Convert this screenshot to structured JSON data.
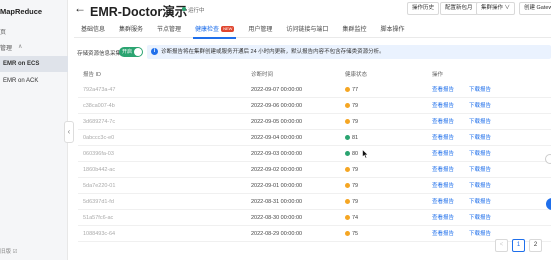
{
  "sidebar": {
    "brand": "MapReduce",
    "home": "页",
    "group_label": "管理",
    "items": [
      {
        "label": "EMR on ECS",
        "active": true
      },
      {
        "label": "EMR on ACK",
        "active": false
      }
    ],
    "footer": "旧版 ☑"
  },
  "header": {
    "back_icon": "arrow-left-icon",
    "title": "EMR-Doctor演示",
    "status": "运行中",
    "buttons": [
      "操作历史",
      "配置新包月",
      "集群操作 ∨",
      "创建 Gatewa"
    ]
  },
  "tabs": [
    {
      "label": "基础信息",
      "active": false
    },
    {
      "label": "集群服务",
      "active": false
    },
    {
      "label": "节点管理",
      "active": false
    },
    {
      "label": "健康检查",
      "active": true,
      "badge": "NEW"
    },
    {
      "label": "用户管理",
      "active": false
    },
    {
      "label": "访问链接与端口",
      "active": false
    },
    {
      "label": "集群监控",
      "active": false
    },
    {
      "label": "脚本操作",
      "active": false
    }
  ],
  "toggle": {
    "label": "存储资源信息采集",
    "state_text": "开启",
    "on": true
  },
  "notice": "诊断报告将在集群创建或服务开通后 24 小时内更新，默认报告内容不包含存储类资源分析。",
  "table": {
    "columns": [
      "报告 ID",
      "诊断时间",
      "健康状态",
      "操作"
    ],
    "actions": [
      "查看报告",
      "下载报告"
    ],
    "rows": [
      {
        "id": "792a473a-47",
        "time": "2022-09-07 00:00:00",
        "score": "77",
        "color": "#f5a623"
      },
      {
        "id": "c38ca007-4b",
        "time": "2022-09-06 00:00:00",
        "score": "79",
        "color": "#f5a623"
      },
      {
        "id": "3d689274-7c",
        "time": "2022-09-05 00:00:00",
        "score": "79",
        "color": "#f5a623"
      },
      {
        "id": "0abccc3c-e0",
        "time": "2022-09-04 00:00:00",
        "score": "81",
        "color": "#2ba471"
      },
      {
        "id": "060396fa-03",
        "time": "2022-09-03 00:00:00",
        "score": "80",
        "color": "#2ba471"
      },
      {
        "id": "1860b442-ac",
        "time": "2022-09-02 00:00:00",
        "score": "79",
        "color": "#f5a623"
      },
      {
        "id": "5da7e220-01",
        "time": "2022-09-01 00:00:00",
        "score": "79",
        "color": "#f5a623"
      },
      {
        "id": "5d6397d1-fd",
        "time": "2022-08-31 00:00:00",
        "score": "79",
        "color": "#f5a623"
      },
      {
        "id": "51a57fc6-ac",
        "time": "2022-08-30 00:00:00",
        "score": "74",
        "color": "#f5a623"
      },
      {
        "id": "1088493c-64",
        "time": "2022-08-29 00:00:00",
        "score": "75",
        "color": "#f5a623"
      }
    ]
  },
  "pagination": {
    "prev": "<",
    "pages": [
      "1",
      "2"
    ],
    "current": "1"
  }
}
